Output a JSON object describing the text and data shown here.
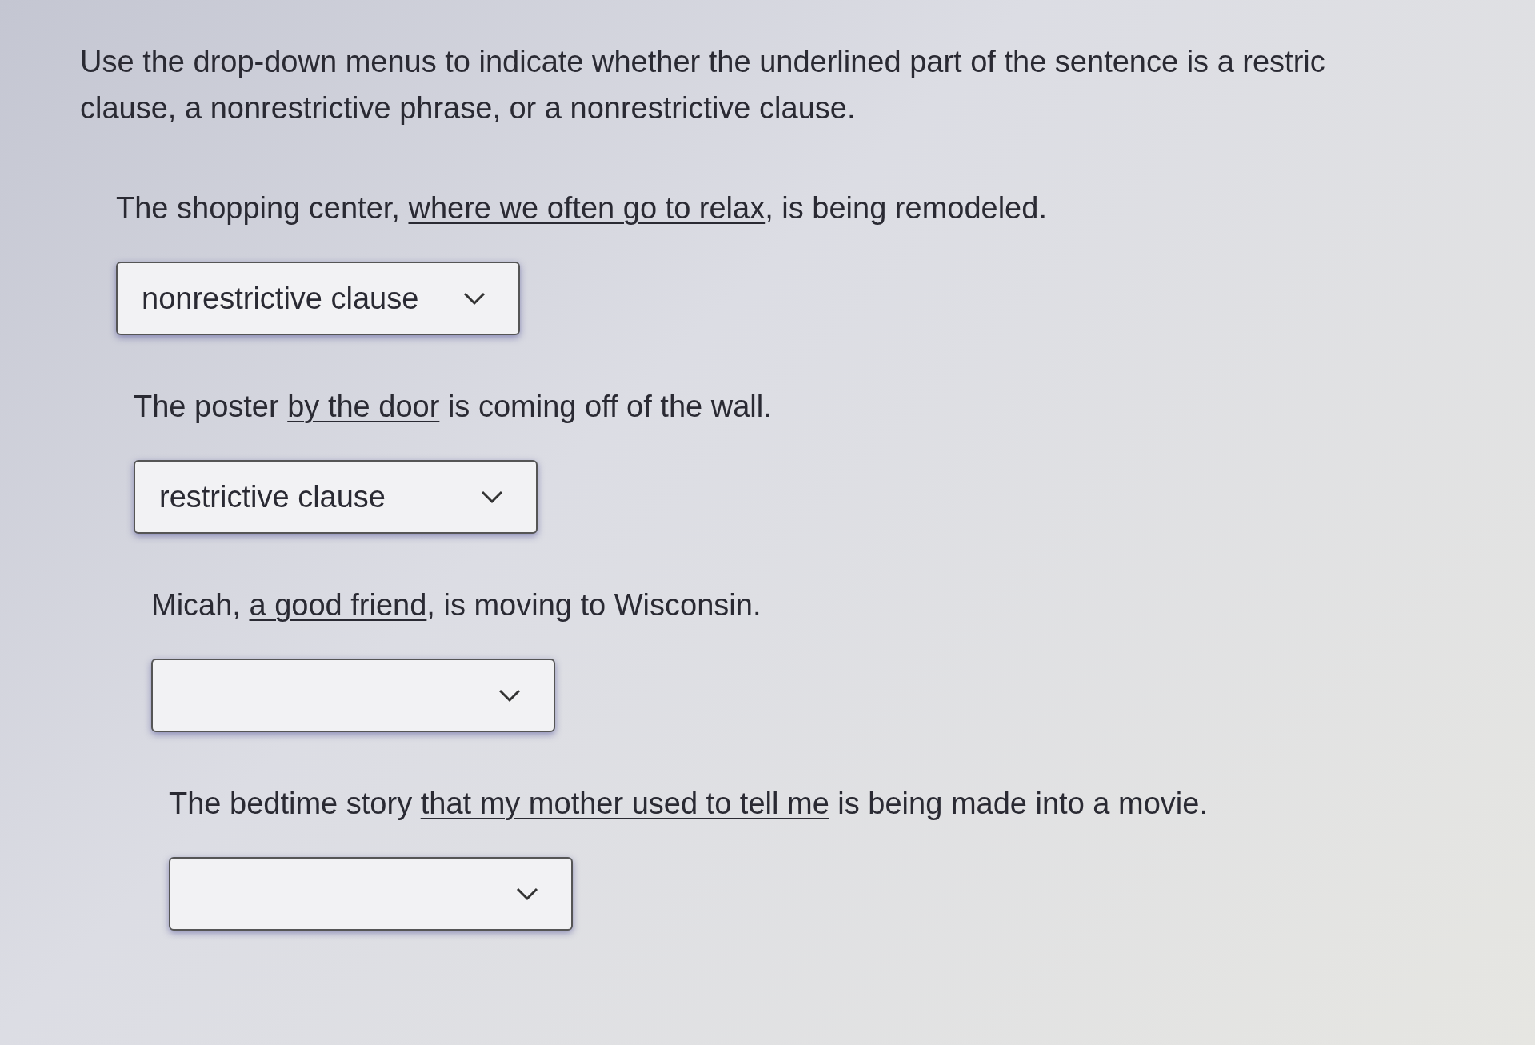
{
  "instruction_lines": [
    "Use the drop-down menus to indicate whether the underlined part of the sentence is a restric",
    "clause, a nonrestrictive phrase, or a nonrestrictive clause."
  ],
  "questions": [
    {
      "before": "The shopping center, ",
      "underlined": "where we often go to relax",
      "after": ", is being remodeled.",
      "answer": "nonrestrictive clause"
    },
    {
      "before": "The poster ",
      "underlined": "by the door",
      "after": " is coming off of the wall.",
      "answer": "restrictive clause"
    },
    {
      "before": "Micah, ",
      "underlined": "a good friend",
      "after": ", is moving to Wisconsin."
    },
    {
      "before": "The bedtime story ",
      "underlined": "that my mother used to tell me",
      "after": " is being made into a movie."
    }
  ]
}
